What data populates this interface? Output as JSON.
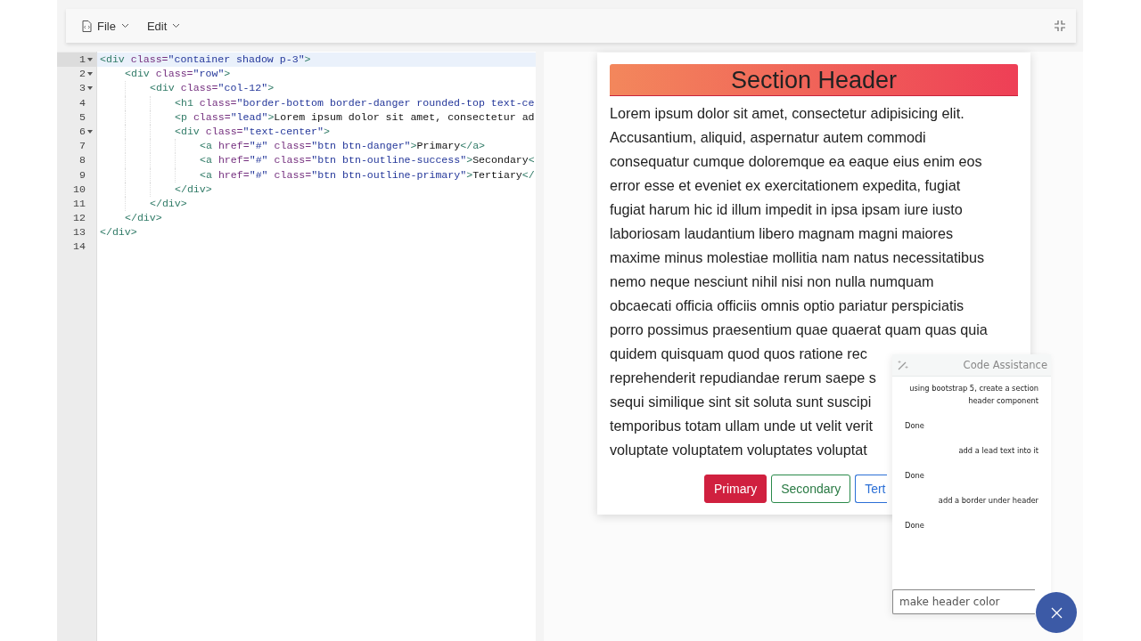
{
  "toolbar": {
    "menus": [
      {
        "label": "File",
        "kind": "file"
      },
      {
        "label": "Edit",
        "kind": "plain"
      }
    ]
  },
  "editor": {
    "lines": [
      {
        "number": "1",
        "active": true,
        "expanded": true,
        "tokens": [
          {
            "kind": "tag",
            "text": "<div"
          },
          {
            "kind": "attr",
            "text": " class="
          },
          {
            "kind": "str",
            "text": "\"container shadow p-3\""
          },
          {
            "kind": "tag",
            "text": ">"
          }
        ],
        "children": [
          {
            "number": "2",
            "active": false,
            "expanded": true,
            "tokens": [
              {
                "kind": "tag",
                "text": "<div"
              },
              {
                "kind": "attr",
                "text": " class="
              },
              {
                "kind": "str",
                "text": "\"row\""
              },
              {
                "kind": "tag",
                "text": ">"
              }
            ],
            "children": [
              {
                "number": "3",
                "active": false,
                "expanded": true,
                "tokens": [
                  {
                    "kind": "tag",
                    "text": "<div"
                  },
                  {
                    "kind": "attr",
                    "text": " class="
                  },
                  {
                    "kind": "str",
                    "text": "\"col-12\""
                  },
                  {
                    "kind": "tag",
                    "text": ">"
                  }
                ],
                "children": [
                  {
                    "number": "4",
                    "active": false,
                    "tokens": [
                      {
                        "kind": "tag",
                        "text": "<h1"
                      },
                      {
                        "kind": "attr",
                        "text": " class="
                      },
                      {
                        "kind": "str",
                        "text": "\"border-bottom border-danger rounded-top text-ce"
                      }
                    ]
                  },
                  {
                    "number": "5",
                    "active": false,
                    "tokens": [
                      {
                        "kind": "tag",
                        "text": "<p"
                      },
                      {
                        "kind": "attr",
                        "text": " class="
                      },
                      {
                        "kind": "str",
                        "text": "\"lead\""
                      },
                      {
                        "kind": "tag",
                        "text": ">"
                      },
                      {
                        "kind": "text",
                        "text": "Lorem ipsum dolor sit amet, consectetur ad"
                      }
                    ]
                  },
                  {
                    "number": "6",
                    "active": false,
                    "expanded": true,
                    "tokens": [
                      {
                        "kind": "tag",
                        "text": "<div"
                      },
                      {
                        "kind": "attr",
                        "text": " class="
                      },
                      {
                        "kind": "str",
                        "text": "\"text-center\""
                      },
                      {
                        "kind": "tag",
                        "text": ">"
                      }
                    ],
                    "children": [
                      {
                        "number": "7",
                        "active": false,
                        "tokens": [
                          {
                            "kind": "tag",
                            "text": "<a"
                          },
                          {
                            "kind": "attr",
                            "text": " href="
                          },
                          {
                            "kind": "str",
                            "text": "\"#\""
                          },
                          {
                            "kind": "attr",
                            "text": " class="
                          },
                          {
                            "kind": "str",
                            "text": "\"btn btn-danger\""
                          },
                          {
                            "kind": "tag",
                            "text": ">"
                          },
                          {
                            "kind": "text",
                            "text": "Primary"
                          },
                          {
                            "kind": "tag",
                            "text": "</a>"
                          }
                        ]
                      },
                      {
                        "number": "8",
                        "active": false,
                        "tokens": [
                          {
                            "kind": "tag",
                            "text": "<a"
                          },
                          {
                            "kind": "attr",
                            "text": " href="
                          },
                          {
                            "kind": "str",
                            "text": "\"#\""
                          },
                          {
                            "kind": "attr",
                            "text": " class="
                          },
                          {
                            "kind": "str",
                            "text": "\"btn btn-outline-success\""
                          },
                          {
                            "kind": "tag",
                            "text": ">"
                          },
                          {
                            "kind": "text",
                            "text": "Secondary"
                          },
                          {
                            "kind": "tag",
                            "text": "<"
                          }
                        ]
                      },
                      {
                        "number": "9",
                        "active": false,
                        "tokens": [
                          {
                            "kind": "tag",
                            "text": "<a"
                          },
                          {
                            "kind": "attr",
                            "text": " href="
                          },
                          {
                            "kind": "str",
                            "text": "\"#\""
                          },
                          {
                            "kind": "attr",
                            "text": " class="
                          },
                          {
                            "kind": "str",
                            "text": "\"btn btn-outline-primary\""
                          },
                          {
                            "kind": "tag",
                            "text": ">"
                          },
                          {
                            "kind": "text",
                            "text": "Tertiary"
                          },
                          {
                            "kind": "tag",
                            "text": "</"
                          }
                        ]
                      }
                    ]
                  },
                  {
                    "number": "10",
                    "active": false,
                    "tokens": [
                      {
                        "kind": "tag",
                        "text": "</div>"
                      }
                    ]
                  }
                ]
              },
              {
                "number": "11",
                "active": false,
                "tokens": [
                  {
                    "kind": "tag",
                    "text": "</div>"
                  }
                ]
              }
            ]
          },
          {
            "number": "12",
            "active": false,
            "tokens": [
              {
                "kind": "tag",
                "text": "</div>"
              }
            ]
          }
        ]
      },
      {
        "number": "13",
        "active": false,
        "tokens": [
          {
            "kind": "tag",
            "text": "</div>"
          }
        ]
      },
      {
        "number": "14",
        "active": false
      }
    ]
  },
  "preview": {
    "header": "Section Header",
    "lead_lines": [
      "Lorem ipsum dolor sit amet, consectetur adipisicing elit.",
      "Accusantium, aliquid, aspernatur autem commodi",
      "consequatur cumque doloremque ea eaque eius enim eos",
      "error esse et eveniet ex exercitationem expedita, fugiat",
      "fugiat harum hic id illum impedit in ipsa ipsam iure iusto",
      "laboriosam laudantium libero magnam magni maiores",
      "maxime minus molestiae mollitia nam natus necessitatibus",
      "nemo neque nesciunt nihil nisi non nulla numquam",
      "obcaecati officia officiis omnis optio pariatur perspiciatis",
      "porro possimus praesentium quae quaerat quam quas quia",
      "quidem quisquam quod quos ratione rec",
      "reprehenderit repudiandae rerum saepe s",
      "sequi similique sint sit soluta sunt suscipi",
      "temporibus totam ullam unde ut velit verit",
      "voluptate voluptatem voluptates voluptat"
    ],
    "buttons": [
      {
        "label": "Primary",
        "kind": "danger"
      },
      {
        "label": "Secondary",
        "kind": "outline-success"
      },
      {
        "label": "Tert",
        "kind": "outline-primary"
      }
    ]
  },
  "assistant": {
    "title": "Code Assistance",
    "messages": [
      {
        "kind": "user",
        "text": "using bootstrap 5, create a section header component"
      },
      {
        "kind": "bot",
        "text": "Done"
      },
      {
        "kind": "user",
        "text": "add a lead text into it"
      },
      {
        "kind": "bot",
        "text": "Done"
      },
      {
        "kind": "user",
        "text": "add a border under header"
      },
      {
        "kind": "bot",
        "text": "Done"
      }
    ],
    "input": {
      "value": "make header color"
    }
  }
}
